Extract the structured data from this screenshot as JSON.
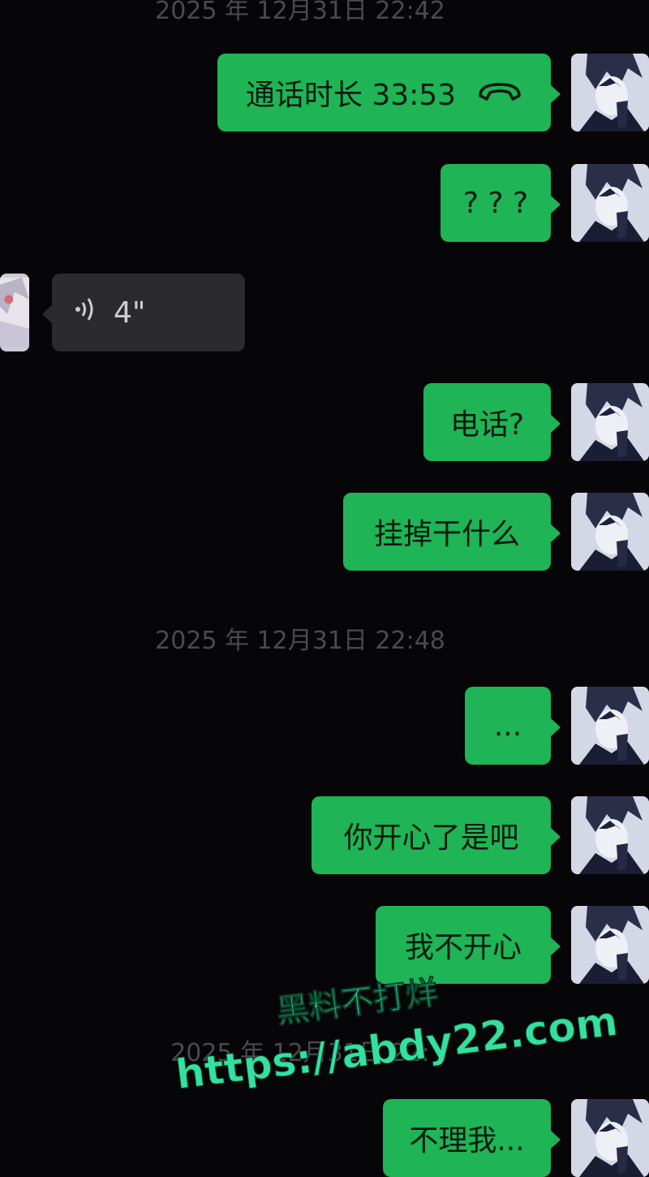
{
  "timestamps": {
    "top": "2025 年 12月31日 22:42",
    "middle": "2025 年 12月31日 22:48",
    "bottom": "2025 年 12月31日 22:"
  },
  "messages": [
    {
      "from": "me",
      "type": "call",
      "text": "通话时长 33:53",
      "icon": "hang-up-phone-icon"
    },
    {
      "from": "me",
      "type": "text",
      "text": "? ? ?"
    },
    {
      "from": "other",
      "type": "voice",
      "text": "4\"",
      "icon": "voice-wave-icon"
    },
    {
      "from": "me",
      "type": "text",
      "text": "电话?"
    },
    {
      "from": "me",
      "type": "text",
      "text": "挂掉干什么"
    },
    {
      "from": "me",
      "type": "text",
      "text": "..."
    },
    {
      "from": "me",
      "type": "text",
      "text": "你开心了是吧"
    },
    {
      "from": "me",
      "type": "text",
      "text": "我不开心"
    },
    {
      "from": "me",
      "type": "text",
      "text": "不理我..."
    }
  ],
  "watermark": {
    "line1": "黑料不打烊",
    "line2": "https://abdy22.com"
  },
  "colors": {
    "background": "#060508",
    "my_bubble": "#1fb455",
    "other_bubble": "#2b2b2f",
    "timestamp": "#4a4a4e",
    "watermark": "#34e0a0"
  }
}
